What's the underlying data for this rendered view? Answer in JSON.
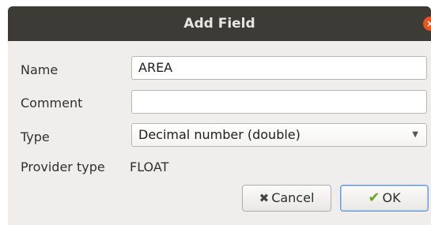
{
  "window": {
    "title": "Add Field",
    "close_glyph": "×"
  },
  "form": {
    "name_label": "Name",
    "name_value": "AREA",
    "comment_label": "Comment",
    "comment_value": "",
    "type_label": "Type",
    "type_selected": "Decimal number (double)",
    "provider_label": "Provider type",
    "provider_value": "FLOAT"
  },
  "buttons": {
    "cancel_label": "Cancel",
    "ok_label": "OK",
    "cancel_icon": "✖",
    "ok_icon": "✔"
  },
  "colors": {
    "titlebar": "#3d3b36",
    "close_button": "#e95420",
    "dialog_bg": "#efeeec",
    "ok_border": "#6a9ccf",
    "ok_check": "#6aa41f"
  }
}
